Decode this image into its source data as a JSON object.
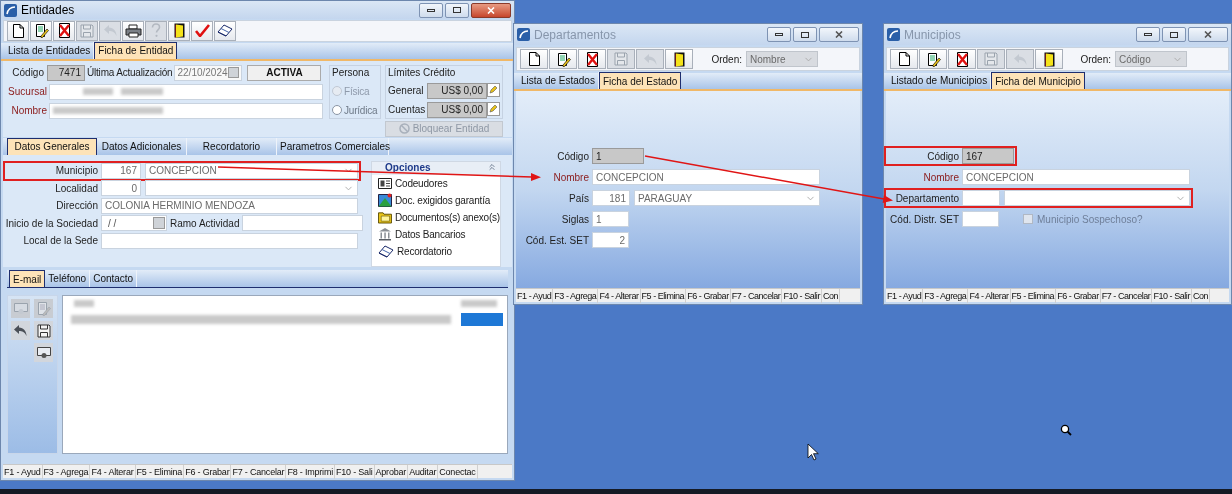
{
  "windows": [
    {
      "kind": "entidades",
      "title": "Entidades",
      "active": true,
      "toolbar": [
        {
          "kind": "new",
          "disabled": false
        },
        {
          "kind": "edit",
          "disabled": false
        },
        {
          "kind": "delete",
          "disabled": false
        },
        {
          "kind": "save",
          "disabled": true
        },
        {
          "kind": "undo",
          "disabled": true
        },
        {
          "kind": "print",
          "disabled": false
        },
        {
          "kind": "help",
          "disabled": true
        },
        {
          "kind": "exit",
          "disabled": false
        },
        {
          "kind": "check",
          "disabled": false
        },
        {
          "kind": "eraser",
          "disabled": false
        }
      ],
      "tabs": [
        {
          "label": "Lista de Entidades",
          "selected": false
        },
        {
          "label": "Ficha de Entidad",
          "selected": true
        }
      ],
      "header": {
        "code_label": "Código",
        "code": "7471",
        "updated_label": "Última Actualización",
        "updated": "22/10/2024",
        "status": "ACTIVA",
        "fields": [
          {
            "label": "Sucursal",
            "required": true
          },
          {
            "label": "Nombre",
            "required": true
          }
        ],
        "persona": {
          "title": "Persona",
          "options": [
            {
              "label": "Física",
              "selected": false,
              "disabled": true
            },
            {
              "label": "Jurídica",
              "selected": false,
              "disabled": false
            }
          ]
        },
        "credit": {
          "title": "Límites Crédito",
          "rows": [
            {
              "label": "General",
              "value": "US$ 0,00"
            },
            {
              "label": "Cuentas",
              "value": "US$ 0,00"
            }
          ],
          "button": {
            "label": "Bloquear Entidad",
            "disabled": true
          }
        }
      },
      "section_tabs": [
        {
          "label": "Datos Generales",
          "selected": true
        },
        {
          "label": "Datos Adicionales",
          "selected": false
        },
        {
          "label": "Recordatorio",
          "selected": false
        },
        {
          "label": "Parametros Comerciales",
          "selected": false
        }
      ],
      "fields": [
        {
          "kind": "lookup",
          "label": "Municipio",
          "code": "167",
          "value": "CONCEPCION",
          "required": false,
          "highlighted": true
        },
        {
          "kind": "lookup",
          "label": "Localidad",
          "code": "0",
          "required": false,
          "highlighted": false
        },
        {
          "kind": "text",
          "label": "Dirección",
          "value": "COLONIA HERMINIO MENDOZA",
          "required": false,
          "highlighted": false
        },
        {
          "kind": "date_pair",
          "label": "Inicio de la Sociedad",
          "value": "/ /",
          "label2": "Ramo Actividad",
          "required": false,
          "highlighted": false
        },
        {
          "kind": "text",
          "label": "Local de la Sede",
          "required": false,
          "highlighted": false
        }
      ],
      "options": {
        "title": "Opciones",
        "items": [
          {
            "kind": "card",
            "label": "Codeudores"
          },
          {
            "kind": "image",
            "label": "Doc. exigidos garantía"
          },
          {
            "kind": "folder",
            "label": "Documentos(s) anexo(s)"
          },
          {
            "kind": "bank",
            "label": "Datos Bancarios"
          },
          {
            "kind": "eraser",
            "label": "Recordatorio"
          }
        ]
      },
      "contact_tabs": [
        {
          "label": "E-mail",
          "selected": true
        },
        {
          "label": "Teléfono",
          "selected": false
        },
        {
          "label": "Contacto",
          "selected": false
        }
      ],
      "contact_tools": [
        {
          "kind": "tray",
          "disabled": true
        },
        {
          "kind": "edit",
          "disabled": true
        },
        {
          "kind": "undo",
          "disabled": false
        },
        {
          "kind": "save",
          "disabled": false
        },
        {
          "kind": "tray",
          "disabled": false
        }
      ],
      "status_bar": [
        "F1 - Ayud",
        "F3 - Agrega",
        "F4 - Alterar",
        "F5 - Elimina",
        "F6 - Grabar",
        "F7 - Cancelar",
        "F8 - Imprimi",
        "F10 - Sali",
        "Aprobar",
        "Auditar",
        "Conectac"
      ]
    },
    {
      "kind": "ficha",
      "title": "Departamentos",
      "active": false,
      "toolbar": [
        {
          "kind": "new",
          "disabled": false
        },
        {
          "kind": "edit",
          "disabled": false
        },
        {
          "kind": "delete",
          "disabled": false
        },
        {
          "kind": "save",
          "disabled": true
        },
        {
          "kind": "undo",
          "disabled": true
        },
        {
          "kind": "exit",
          "disabled": false
        }
      ],
      "order": {
        "label": "Orden:",
        "value": "Nombre"
      },
      "tabs": [
        {
          "label": "Lista de Estados",
          "selected": false
        },
        {
          "label": "Ficha del Estado",
          "selected": true
        }
      ],
      "fields": [
        {
          "kind": "code",
          "label": "Código",
          "value": "1",
          "required": false,
          "highlighted": false
        },
        {
          "kind": "text",
          "label": "Nombre",
          "value": "CONCEPCION",
          "required": true,
          "highlighted": false
        },
        {
          "kind": "lookup",
          "label": "País",
          "code": "181",
          "value": "PARAGUAY",
          "required": false,
          "highlighted": false
        },
        {
          "kind": "short",
          "label": "Siglas",
          "value": "1",
          "required": false,
          "highlighted": false
        },
        {
          "kind": "number",
          "label": "Cód. Est. SET",
          "value": "2",
          "required": false,
          "highlighted": false
        }
      ],
      "status_bar": [
        "F1 - Ayud",
        "F3 - Agrega",
        "F4 - Alterar",
        "F5 - Elimina",
        "F6 - Grabar",
        "F7 - Cancelar",
        "F10 - Salir",
        "Con"
      ]
    },
    {
      "kind": "ficha",
      "title": "Municipios",
      "active": false,
      "toolbar": [
        {
          "kind": "new",
          "disabled": false
        },
        {
          "kind": "edit",
          "disabled": false
        },
        {
          "kind": "delete",
          "disabled": false
        },
        {
          "kind": "save",
          "disabled": true
        },
        {
          "kind": "undo",
          "disabled": true
        },
        {
          "kind": "exit",
          "disabled": false
        }
      ],
      "order": {
        "label": "Orden:",
        "value": "Código"
      },
      "tabs": [
        {
          "label": "Listado de Municipios",
          "selected": false
        },
        {
          "label": "Ficha del Municipio",
          "selected": true
        }
      ],
      "fields": [
        {
          "kind": "code",
          "label": "Código",
          "value": "167",
          "required": false,
          "highlighted": true
        },
        {
          "kind": "text",
          "label": "Nombre",
          "value": "CONCEPCION",
          "required": true,
          "highlighted": false
        },
        {
          "kind": "lookup",
          "label": "Departamento",
          "required": false,
          "highlighted": true
        },
        {
          "kind": "short_check",
          "label": "Cód. Distr. SET",
          "required": false,
          "highlighted": false,
          "checkbox": {
            "label": "Municipio Sospechoso?",
            "checked": false,
            "disabled": true
          }
        }
      ],
      "status_bar": [
        "F1 - Ayud",
        "F3 - Agrega",
        "F4 - Alterar",
        "F5 - Elimina",
        "F6 - Grabar",
        "F7 - Cancelar",
        "F10 - Salir",
        "Con"
      ]
    }
  ]
}
